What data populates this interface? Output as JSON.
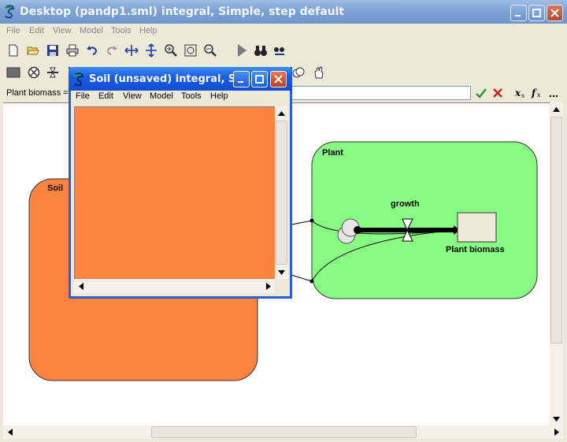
{
  "main": {
    "title": "Desktop (pandp1.sml) integral, Simple, step default",
    "menu": [
      "File",
      "Edit",
      "View",
      "Model",
      "Tools",
      "Help"
    ]
  },
  "formula": {
    "label": "Plant biomass ="
  },
  "diagram": {
    "soil_label": "Soil",
    "plant_label": "Plant",
    "flow_label": "growth",
    "stock_label": "Plant biomass",
    "soil_color": "#fc8340",
    "plant_color": "#88fc82"
  },
  "child": {
    "title": "Soil (unsaved) integral, Si...",
    "menu": [
      "File",
      "Edit",
      "View",
      "Model",
      "Tools",
      "Help"
    ]
  }
}
